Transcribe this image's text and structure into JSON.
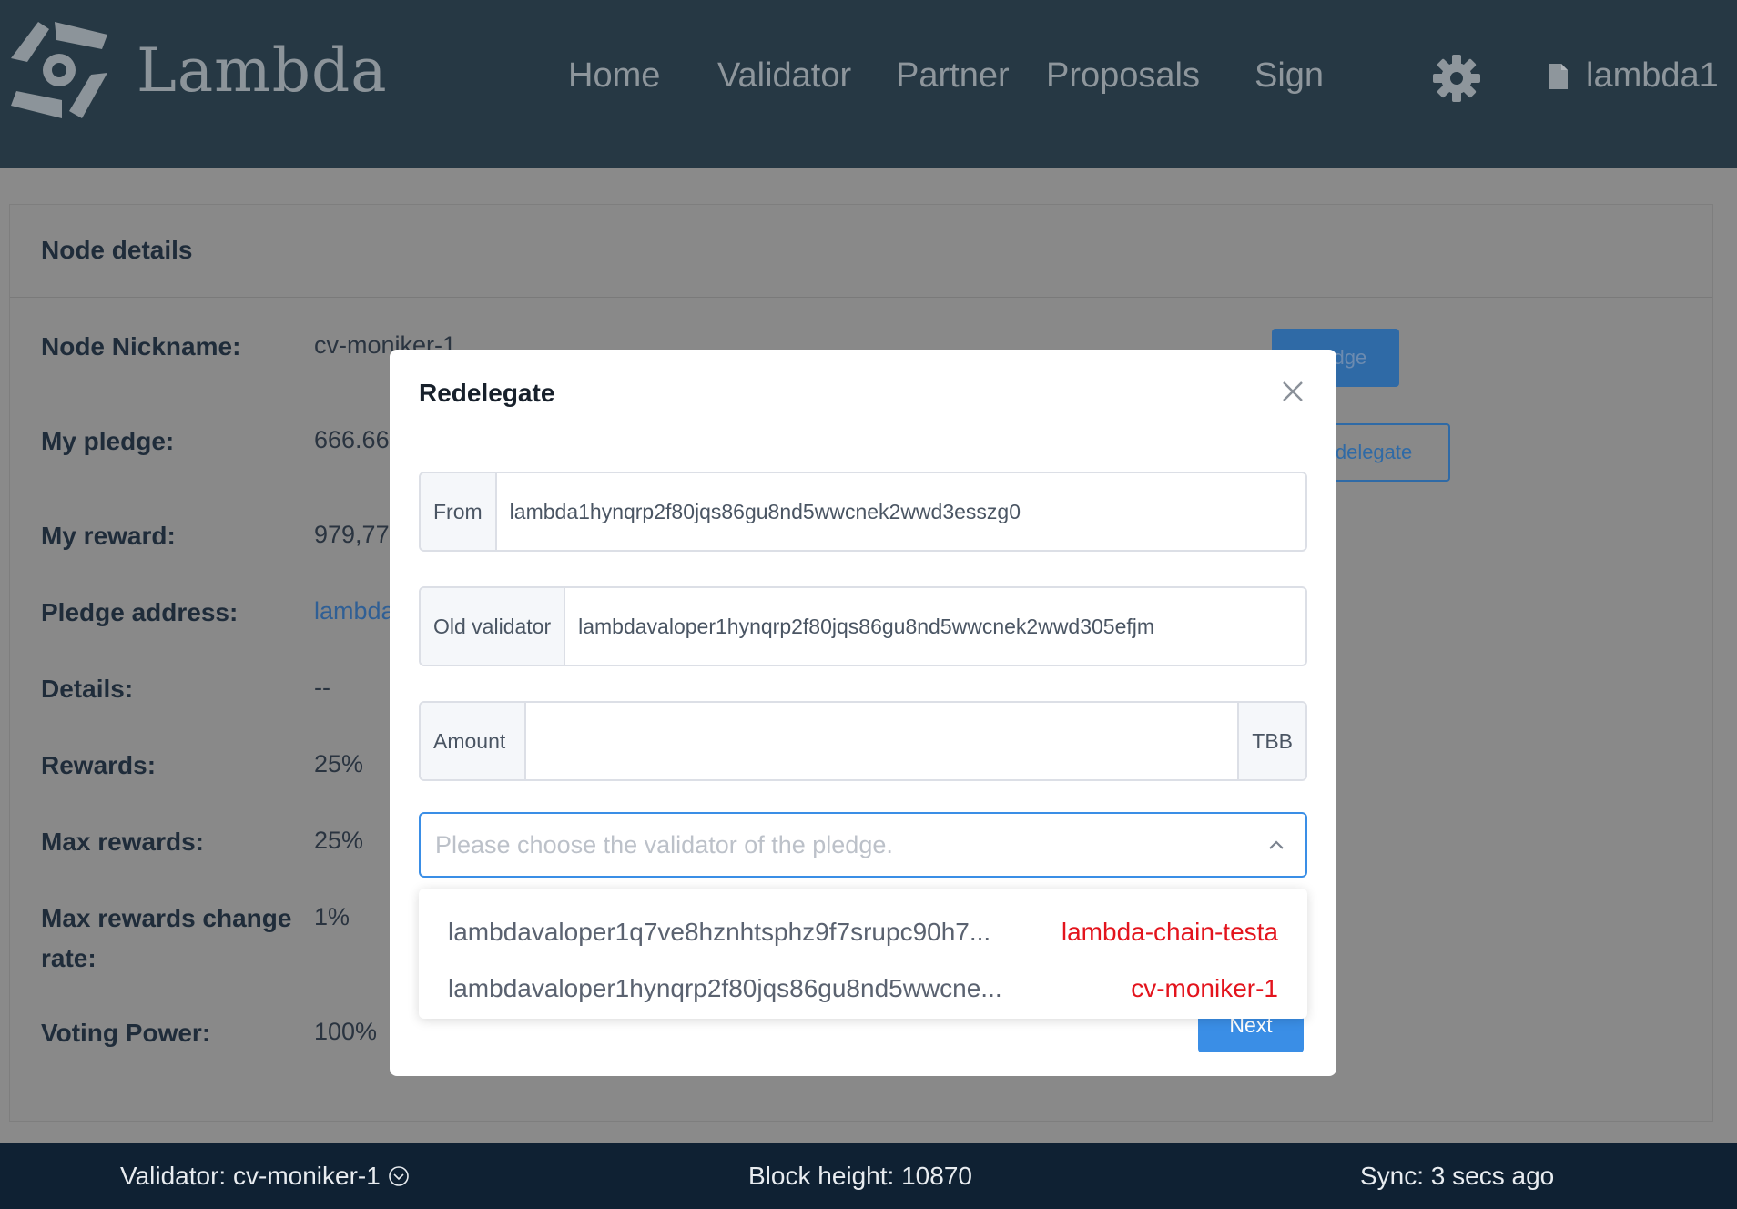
{
  "header": {
    "brand": "Lambda",
    "nav": [
      "Home",
      "Validator",
      "Partner",
      "Proposals",
      "Sign"
    ],
    "account": "lambda1"
  },
  "card": {
    "title": "Node details",
    "rows": [
      {
        "label": "Node Nickname:",
        "value": "cv-moniker-1"
      },
      {
        "label": "My pledge:",
        "value": "666.66"
      },
      {
        "label": "My reward:",
        "value": "979,77"
      },
      {
        "label": "Pledge address:",
        "value": "lambda"
      },
      {
        "label": "Details:",
        "value": "--"
      },
      {
        "label": "Rewards:",
        "value": "25%"
      },
      {
        "label": "Max rewards:",
        "value": "25%"
      },
      {
        "label": "Max rewards change",
        "label2": "rate:",
        "value": "1%"
      },
      {
        "label": "Voting Power:",
        "value": "100%"
      }
    ],
    "pledge_button": "Pledge",
    "redelegate_button": "Redelegate"
  },
  "modal": {
    "title": "Redelegate",
    "from_label": "From",
    "from_value": "lambda1hynqrp2f80jqs86gu8nd5wwcnek2wwd3esszg0",
    "old_validator_label": "Old validator",
    "old_validator_value": "lambdavaloper1hynqrp2f80jqs86gu8nd5wwcnek2wwd305efjm",
    "amount_label": "Amount",
    "amount_value": "",
    "amount_unit": "TBB",
    "select_placeholder": "Please choose the validator of the pledge.",
    "next_button": "Next"
  },
  "dropdown": {
    "options": [
      {
        "address": "lambdavaloper1q7ve8hznhtsphz9f7srupc90h7...",
        "name": "lambda-chain-testa"
      },
      {
        "address": "lambdavaloper1hynqrp2f80jqs86gu8nd5wwcne...",
        "name": "cv-moniker-1"
      }
    ]
  },
  "footer": {
    "validator": "Validator: cv-moniker-1",
    "block_height": "Block height: 10870",
    "sync": "Sync: 3 secs ago"
  },
  "icons": [
    "lambda-logo-icon",
    "gear-icon",
    "document-icon",
    "close-icon",
    "chevron-up-icon",
    "chevron-down-circle-icon"
  ],
  "colors": {
    "header_bg": "#263844",
    "footer_bg": "#0f2133",
    "primary": "#3a8ee6",
    "validator_name": "#e3141d"
  }
}
